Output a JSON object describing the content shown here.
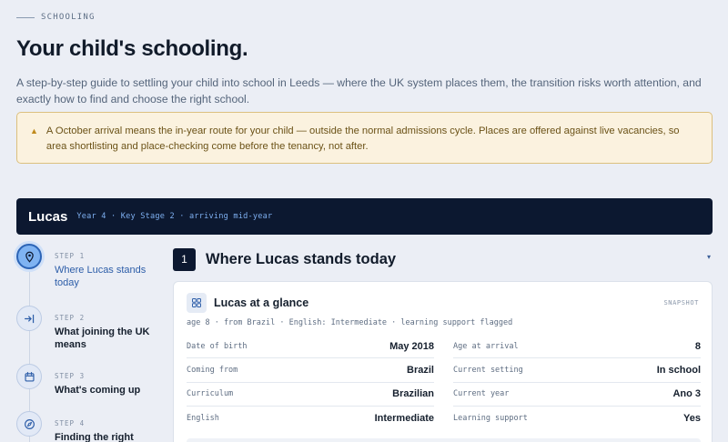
{
  "eyebrow": "SCHOOLING",
  "title": "Your child's schooling.",
  "intro": "A step-by-step guide to settling your child into school in Leeds — where the UK system places them, the transition risks worth attention, and exactly how to find and choose the right school.",
  "notice": {
    "icon": "warning-triangle-icon",
    "text": "A October arrival means the in-year route for your child — outside the normal admissions cycle. Places are offered against live vacancies, so area shortlisting and place-checking come before the tenancy, not after."
  },
  "child": {
    "name": "Lucas",
    "meta": "Year 4 · Key Stage 2 · arriving mid-year"
  },
  "steps": [
    {
      "num": "STEP 1",
      "label": "Where Lucas stands today",
      "icon": "map-pin-icon",
      "active": true
    },
    {
      "num": "STEP 2",
      "label": "What joining the UK means",
      "icon": "arrow-into-icon",
      "active": false
    },
    {
      "num": "STEP 3",
      "label": "What's coming up",
      "icon": "calendar-icon",
      "active": false
    },
    {
      "num": "STEP 4",
      "label": "Finding the right school",
      "icon": "compass-icon",
      "active": false
    }
  ],
  "section": {
    "number": "1",
    "title": "Where Lucas stands today",
    "collapse_icon": "▾"
  },
  "card": {
    "title": "Lucas at a glance",
    "tag": "SNAPSHOT",
    "summary": "age 8 · from Brazil · English: Intermediate · learning support flagged",
    "rows": [
      [
        {
          "k": "Date of birth",
          "v": "May 2018"
        },
        {
          "k": "Age at arrival",
          "v": "8"
        }
      ],
      [
        {
          "k": "Coming from",
          "v": "Brazil"
        },
        {
          "k": "Current setting",
          "v": "In school"
        }
      ],
      [
        {
          "k": "Curriculum",
          "v": "Brazilian"
        },
        {
          "k": "Current year",
          "v": "Ano 3"
        }
      ],
      [
        {
          "k": "English",
          "v": "Intermediate"
        },
        {
          "k": "Learning support",
          "v": "Yes"
        }
      ]
    ]
  },
  "colors": {
    "navy": "#0c1830",
    "accent": "#2c64b6",
    "notice_bg": "#fbf2df",
    "notice_border": "#dcc07e"
  }
}
